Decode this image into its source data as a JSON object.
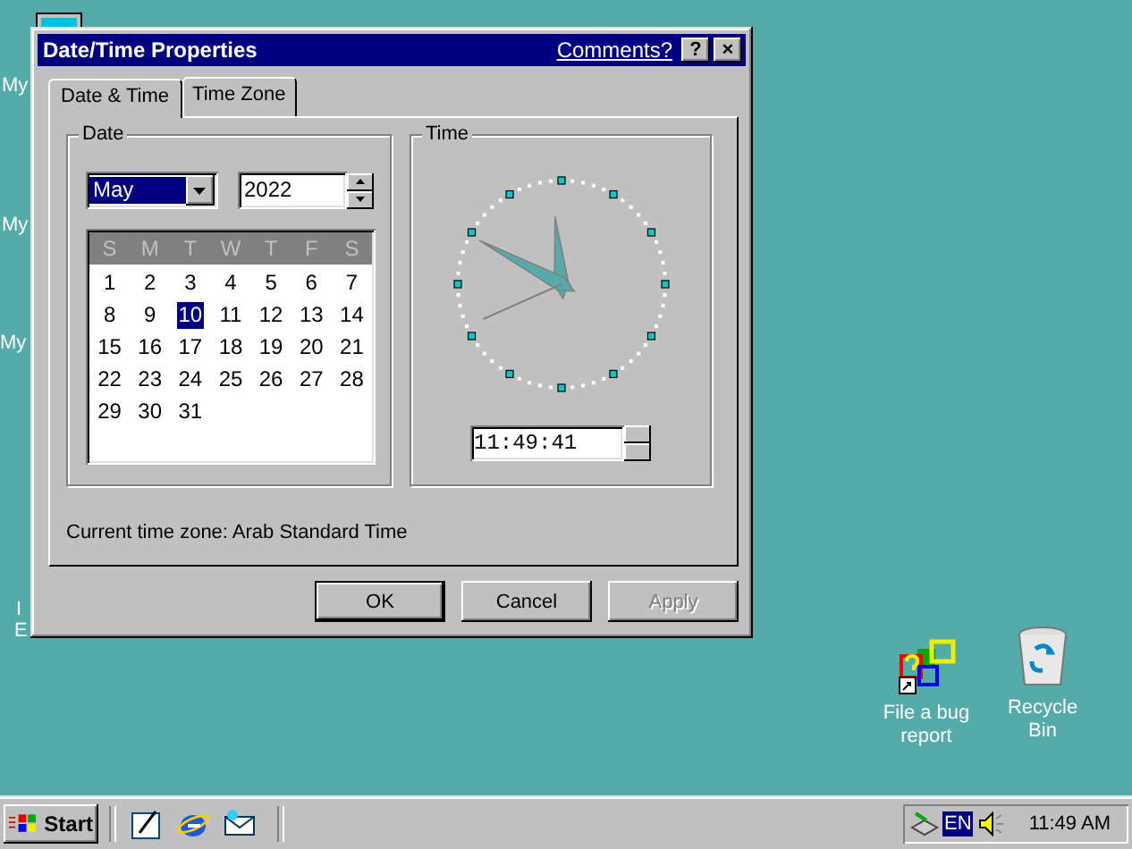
{
  "desktop": {
    "cut_labels": [
      {
        "label": "My"
      },
      {
        "label": "My"
      },
      {
        "label": "My"
      },
      {
        "label": "I"
      },
      {
        "label": "E"
      }
    ],
    "icons": [
      {
        "kind": "bug",
        "label": "File a bug report"
      },
      {
        "kind": "bin",
        "label": "Recycle Bin"
      }
    ]
  },
  "window": {
    "title": "Date/Time Properties",
    "comments_link": "Comments?",
    "help": "?",
    "close": "×",
    "tabs": [
      {
        "label": "Date & Time",
        "selected": true
      },
      {
        "label": "Time Zone",
        "selected": false
      }
    ],
    "date": {
      "label": "Date",
      "month": "May",
      "year": "2022",
      "weekdays": [
        "S",
        "M",
        "T",
        "W",
        "T",
        "F",
        "S"
      ],
      "days": [
        {
          "label": "1",
          "selected": false
        },
        {
          "label": "2",
          "selected": false
        },
        {
          "label": "3",
          "selected": false
        },
        {
          "label": "4",
          "selected": false
        },
        {
          "label": "5",
          "selected": false
        },
        {
          "label": "6",
          "selected": false
        },
        {
          "label": "7",
          "selected": false
        },
        {
          "label": "8",
          "selected": false
        },
        {
          "label": "9",
          "selected": false
        },
        {
          "label": "10",
          "selected": true
        },
        {
          "label": "11",
          "selected": false
        },
        {
          "label": "12",
          "selected": false
        },
        {
          "label": "13",
          "selected": false
        },
        {
          "label": "14",
          "selected": false
        },
        {
          "label": "15",
          "selected": false
        },
        {
          "label": "16",
          "selected": false
        },
        {
          "label": "17",
          "selected": false
        },
        {
          "label": "18",
          "selected": false
        },
        {
          "label": "19",
          "selected": false
        },
        {
          "label": "20",
          "selected": false
        },
        {
          "label": "21",
          "selected": false
        },
        {
          "label": "22",
          "selected": false
        },
        {
          "label": "23",
          "selected": false
        },
        {
          "label": "24",
          "selected": false
        },
        {
          "label": "25",
          "selected": false
        },
        {
          "label": "26",
          "selected": false
        },
        {
          "label": "27",
          "selected": false
        },
        {
          "label": "28",
          "selected": false
        },
        {
          "label": "29",
          "selected": false
        },
        {
          "label": "30",
          "selected": false
        },
        {
          "label": "31",
          "selected": false
        }
      ]
    },
    "time": {
      "label": "Time",
      "value": "11:49:41"
    },
    "timezone": "Current time zone:  Arab Standard Time",
    "buttons": [
      {
        "label": "OK",
        "disabled": false,
        "default": true
      },
      {
        "label": "Cancel",
        "disabled": false,
        "default": false
      },
      {
        "label": "Apply",
        "disabled": true,
        "default": false
      }
    ]
  },
  "taskbar": {
    "start": "Start",
    "language": "EN",
    "clock": "11:49 AM"
  }
}
